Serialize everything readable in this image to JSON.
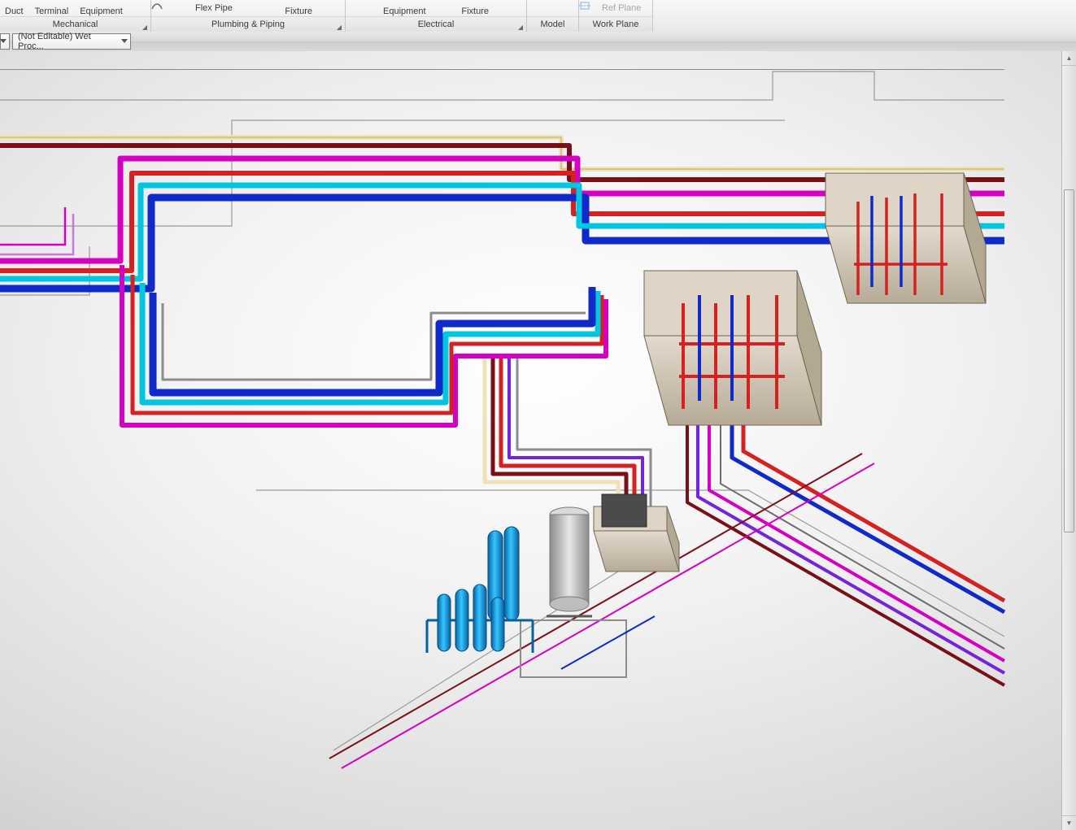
{
  "ribbon": {
    "mechanical": {
      "title": "Mechanical",
      "items": [
        "Duct",
        "Terminal",
        "Equipment"
      ]
    },
    "plumbing": {
      "title": "Plumbing & Piping",
      "flex": "Flex Pipe",
      "fixture": "Fixture"
    },
    "electrical": {
      "title": "Electrical",
      "equipment": "Equipment",
      "fixture": "Fixture"
    },
    "model": {
      "title": "Model"
    },
    "workplane": {
      "title": "Work Plane",
      "refplane": "Ref Plane"
    }
  },
  "optionsbar": {
    "view": "(Not Editable) Wet Proc..."
  },
  "pipe_colors": {
    "blue": "#1029c9",
    "cyan": "#00c6e0",
    "magenta": "#d400c3",
    "darkred": "#7a0f18",
    "red": "#d42121",
    "cream": "#efe2b4",
    "grey": "#8c8c8c",
    "purple": "#7425d9",
    "tankBlue": "#0e9ae0",
    "steel": "#b8b8b8",
    "box": "#cfc4b4"
  }
}
